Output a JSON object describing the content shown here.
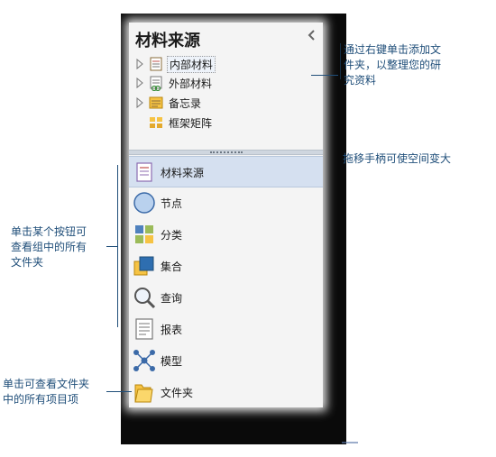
{
  "panel": {
    "title": "材料来源",
    "collapse_glyph": "‹",
    "tree": [
      {
        "label": "内部材料",
        "icon": "internal-materials-icon",
        "selected": true
      },
      {
        "label": "外部材料",
        "icon": "external-materials-icon",
        "selected": false
      },
      {
        "label": "备忘录",
        "icon": "memo-icon",
        "selected": false
      },
      {
        "label": "框架矩阵",
        "icon": "framework-matrix-icon",
        "selected": false
      }
    ],
    "nav": [
      {
        "label": "材料来源",
        "icon": "sources-icon",
        "active": true
      },
      {
        "label": "节点",
        "icon": "node-icon",
        "active": false
      },
      {
        "label": "分类",
        "icon": "classification-icon",
        "active": false
      },
      {
        "label": "集合",
        "icon": "sets-icon",
        "active": false
      },
      {
        "label": "查询",
        "icon": "query-icon",
        "active": false
      },
      {
        "label": "报表",
        "icon": "reports-icon",
        "active": false
      },
      {
        "label": "模型",
        "icon": "model-icon",
        "active": false
      },
      {
        "label": "文件夹",
        "icon": "folder-icon",
        "active": false
      }
    ]
  },
  "callouts": {
    "right_top": [
      "通过右键单击添加文",
      "件夹，以整理您的研",
      "究资料"
    ],
    "right_mid": "拖移手柄可使空间变大",
    "left_mid": [
      "单击某个按钮可",
      "查看组中的所有",
      "文件夹"
    ],
    "left_bottom": [
      "单击可查看文件夹",
      "中的所有项目项"
    ]
  },
  "colors": {
    "callout_text": "#1f4e79",
    "active_nav": "#d5e0f0",
    "frame": "#0a0a0a"
  }
}
